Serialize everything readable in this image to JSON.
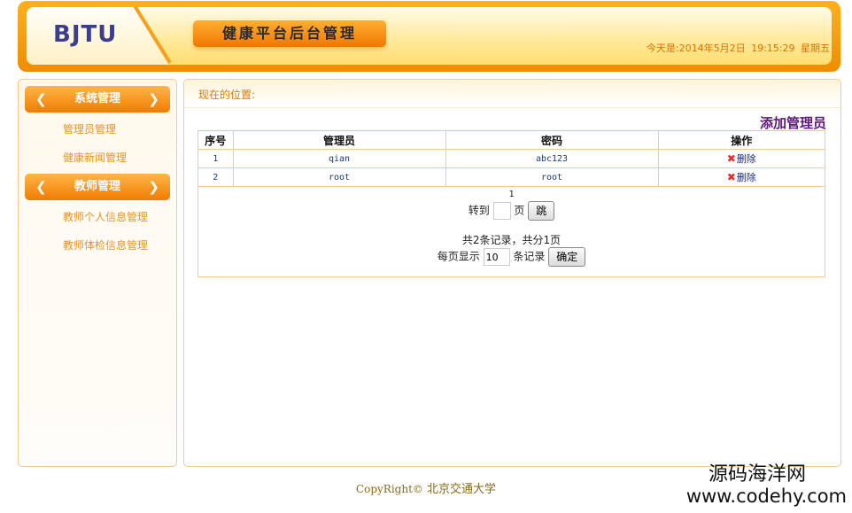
{
  "header": {
    "logo": "BJTU",
    "title": "健康平台后台管理",
    "date_label": "今天是:",
    "date": "2014年5月2日",
    "time": "19:15:29",
    "weekday": "星期五"
  },
  "sidebar": {
    "groups": [
      {
        "label": "系统管理",
        "items": [
          "管理员管理",
          "健康新闻管理"
        ]
      },
      {
        "label": "教师管理",
        "items": [
          "教师个人信息管理",
          "教师体检信息管理"
        ]
      }
    ]
  },
  "main": {
    "breadcrumb": "现在的位置:",
    "add_link": "添加管理员",
    "columns": [
      "序号",
      "管理员",
      "密码",
      "操作"
    ],
    "rows": [
      {
        "no": "1",
        "name": "qian",
        "password": "abc123",
        "action": "删除"
      },
      {
        "no": "2",
        "name": "root",
        "password": "root",
        "action": "删除"
      }
    ],
    "pager": {
      "current_page": "1",
      "goto_label": "转到",
      "page_unit": "页",
      "goto_value": "",
      "jump_button": "跳",
      "summary": "共2条记录，共分1页",
      "per_page_label": "每页显示",
      "per_page_value": "10",
      "records_unit": "条记录",
      "confirm_button": "确定"
    }
  },
  "footer": {
    "copyright": "CopyRight©",
    "org": "北京交通大学"
  },
  "watermark": {
    "cn": "源码海洋网",
    "url": "www.codehy.com"
  },
  "colors": {
    "header_orange": "#f08c00",
    "menu_orange": "#f07c00",
    "border": "#f6c98c",
    "link_purple": "#5b1a7a",
    "delete_red": "#e03030"
  }
}
